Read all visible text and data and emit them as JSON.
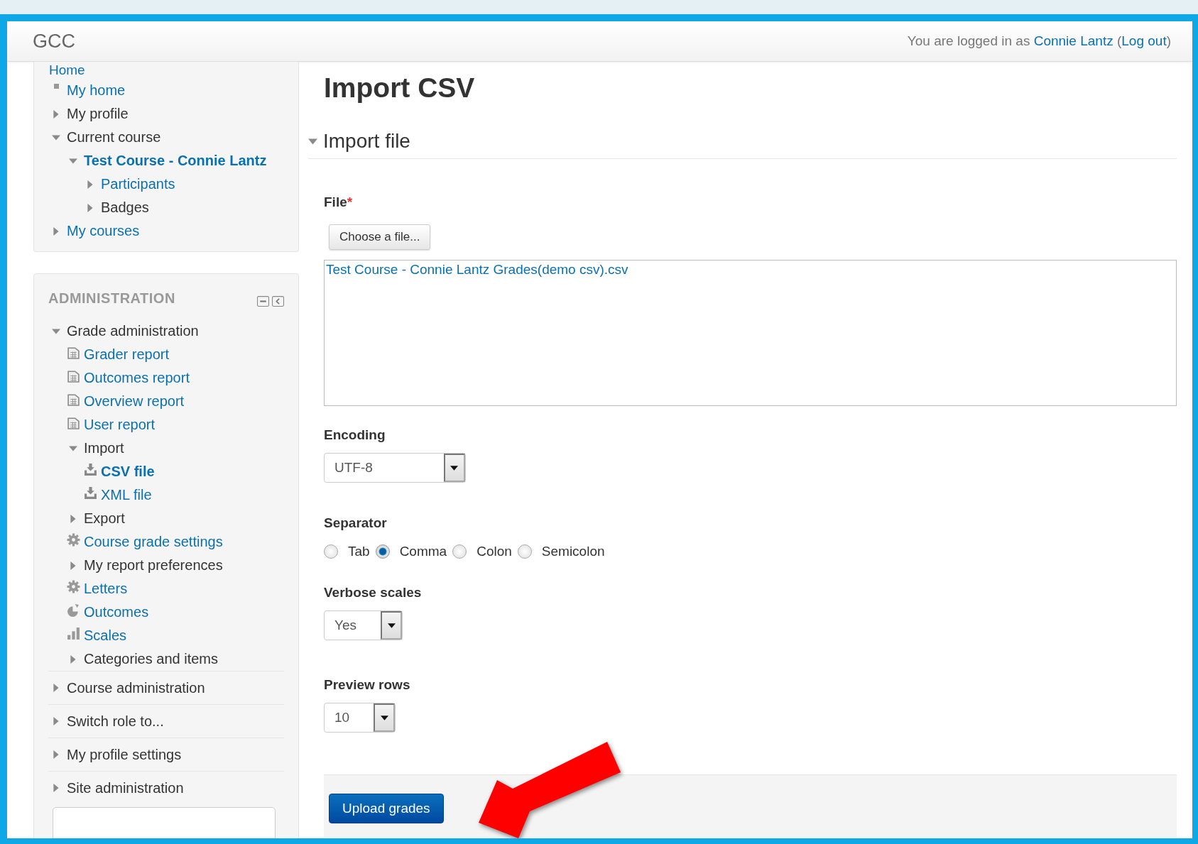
{
  "header": {
    "site_name": "GCC",
    "login_text": "You are logged in as",
    "user": "Connie Lantz",
    "open": "(",
    "logout": "Log out",
    "close": ")"
  },
  "navigation": {
    "home": "Home",
    "items": [
      {
        "label": "My home",
        "kind": "bullet",
        "link": true,
        "active": false
      },
      {
        "label": "My profile",
        "kind": "branch",
        "expanded": false,
        "link": false,
        "active": false
      },
      {
        "label": "Current course",
        "kind": "branch",
        "expanded": true,
        "link": false,
        "active": false,
        "children": [
          {
            "label": "Test Course - Connie Lantz",
            "kind": "branch",
            "expanded": true,
            "link": true,
            "active": true,
            "children": [
              {
                "label": "Participants",
                "kind": "branch",
                "expanded": false,
                "link": true,
                "active": false
              },
              {
                "label": "Badges",
                "kind": "branch",
                "expanded": false,
                "link": false,
                "active": false
              }
            ]
          }
        ]
      },
      {
        "label": "My courses",
        "kind": "branch",
        "expanded": false,
        "link": true,
        "active": false
      }
    ]
  },
  "administration": {
    "title": "ADMINISTRATION",
    "sections": [
      {
        "label": "Grade administration",
        "kind": "branch",
        "expanded": true,
        "link": false,
        "active": false,
        "children": [
          {
            "label": "Grader report",
            "kind": "report",
            "link": true,
            "active": false
          },
          {
            "label": "Outcomes report",
            "kind": "report",
            "link": true,
            "active": false
          },
          {
            "label": "Overview report",
            "kind": "report",
            "link": true,
            "active": false
          },
          {
            "label": "User report",
            "kind": "report",
            "link": true,
            "active": false
          },
          {
            "label": "Import",
            "kind": "branch",
            "expanded": true,
            "link": false,
            "active": false,
            "children": [
              {
                "label": "CSV file",
                "kind": "download",
                "link": true,
                "active": true
              },
              {
                "label": "XML file",
                "kind": "download",
                "link": true,
                "active": false
              }
            ]
          },
          {
            "label": "Export",
            "kind": "branch",
            "expanded": false,
            "link": false,
            "active": false
          },
          {
            "label": "Course grade settings",
            "kind": "gear",
            "link": true,
            "active": false
          },
          {
            "label": "My report preferences",
            "kind": "branch",
            "expanded": false,
            "link": false,
            "active": false
          },
          {
            "label": "Letters",
            "kind": "gear",
            "link": true,
            "active": false
          },
          {
            "label": "Outcomes",
            "kind": "pie",
            "link": true,
            "active": false
          },
          {
            "label": "Scales",
            "kind": "bars",
            "link": true,
            "active": false
          },
          {
            "label": "Categories and items",
            "kind": "branch",
            "expanded": false,
            "link": false,
            "active": false
          }
        ]
      },
      {
        "label": "Course administration",
        "kind": "branch",
        "expanded": false,
        "link": false,
        "active": false
      },
      {
        "label": "Switch role to...",
        "kind": "branch",
        "expanded": false,
        "link": false,
        "active": false
      },
      {
        "label": "My profile settings",
        "kind": "branch",
        "expanded": false,
        "link": false,
        "active": false
      },
      {
        "label": "Site administration",
        "kind": "branch",
        "expanded": false,
        "link": false,
        "active": false
      }
    ]
  },
  "main": {
    "title": "Import CSV",
    "section": {
      "title": "Import file",
      "expanded": true
    },
    "fields": [
      {
        "kind": "file",
        "label": "File",
        "required_mark": "*",
        "button": "Choose a file...",
        "files": [
          "Test Course - Connie Lantz Grades(demo csv).csv"
        ]
      },
      {
        "kind": "select",
        "label": "Encoding",
        "value": "UTF-8"
      },
      {
        "kind": "radio",
        "label": "Separator",
        "options": [
          {
            "label": "Tab",
            "selected": false
          },
          {
            "label": "Comma",
            "selected": true
          },
          {
            "label": "Colon",
            "selected": false
          },
          {
            "label": "Semicolon",
            "selected": false
          }
        ]
      },
      {
        "kind": "select",
        "label": "Verbose scales",
        "value": "Yes"
      },
      {
        "kind": "select",
        "label": "Preview rows",
        "value": "10"
      }
    ],
    "submit": "Upload grades"
  }
}
